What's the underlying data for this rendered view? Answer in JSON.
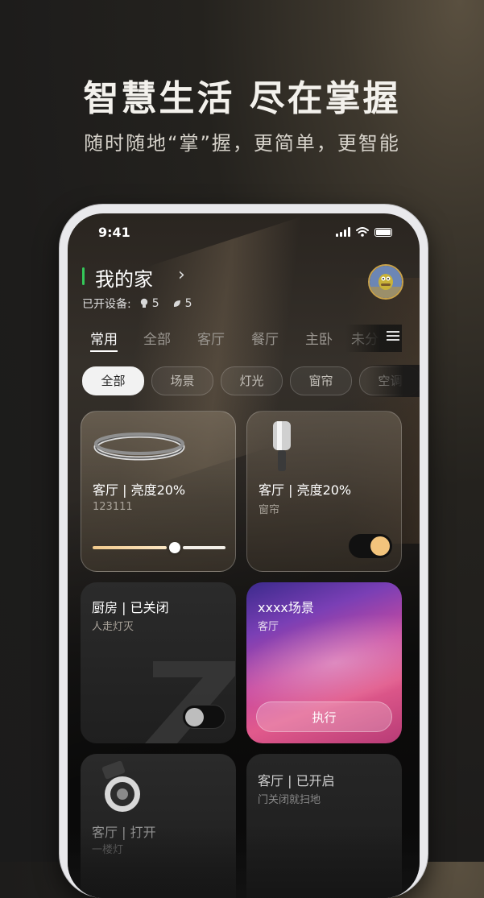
{
  "promo": {
    "title": "智慧生活 尽在掌握",
    "subtitle": "随时随地“掌”握，更简单，更智能"
  },
  "status_bar": {
    "time": "9:41"
  },
  "home": {
    "title": "我的家",
    "stats_label": "已开设备:",
    "lights_count": "5",
    "plugs_count": "5"
  },
  "room_tabs": [
    "常用",
    "全部",
    "客厅",
    "餐厅",
    "主卧",
    "未分"
  ],
  "active_tab": "常用",
  "filter_chips": [
    "全部",
    "场景",
    "灯光",
    "窗帘",
    "空调"
  ],
  "active_chip": "全部",
  "cards": [
    {
      "title": "客厅 | 亮度20%",
      "subtitle": "123111",
      "brightness_percent": 20
    },
    {
      "title": "客厅 | 亮度20%",
      "subtitle": "窗帘",
      "toggle_on": true
    },
    {
      "title": "厨房 | 已关闭",
      "subtitle": "人走灯灭",
      "toggle_on": false
    },
    {
      "title": "xxxx场景",
      "subtitle": "客厅",
      "button": "执行"
    },
    {
      "title": "客厅 | 打开",
      "subtitle": "一楼灯"
    },
    {
      "title": "客厅 | 已开启",
      "subtitle": "门关闭就扫地"
    }
  ],
  "colors": {
    "accent_green": "#34c759",
    "toggle_knob_on": "#f3c47c",
    "slider_fill": "#f1c98c"
  }
}
